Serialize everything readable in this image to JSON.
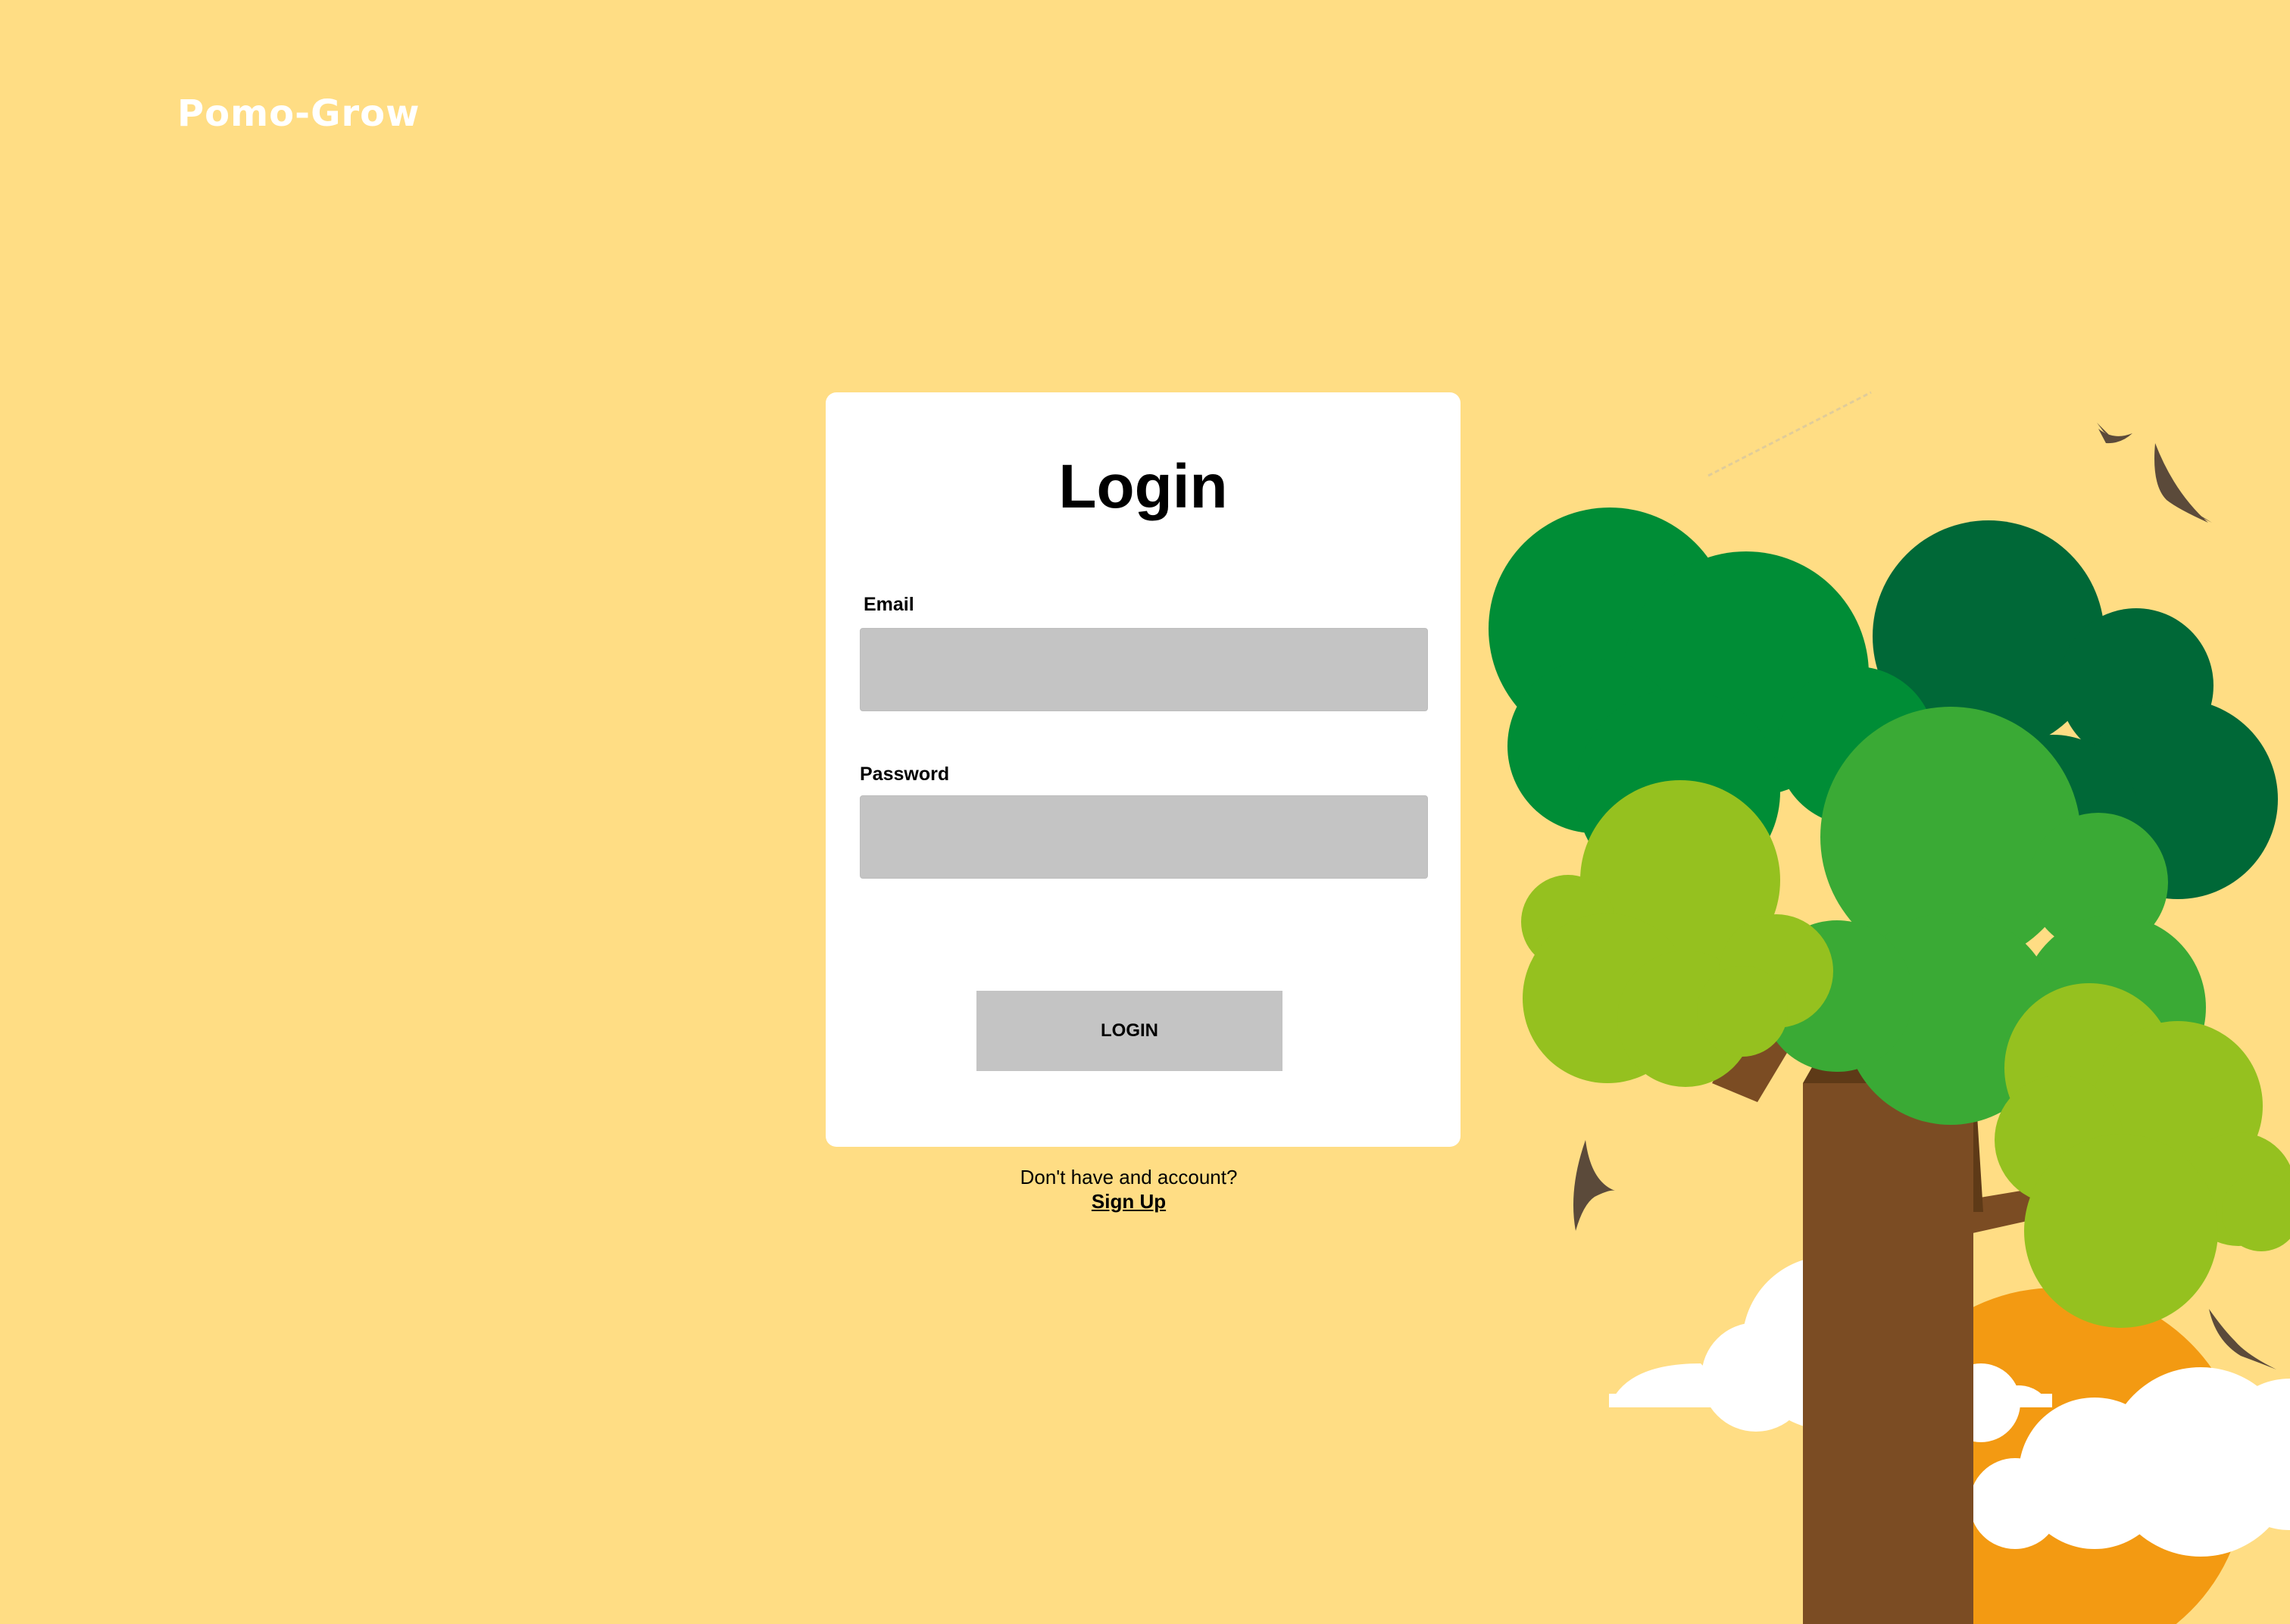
{
  "app": {
    "brand": "Pomo-Grow"
  },
  "login_card": {
    "title": "Login",
    "email_label": "Email",
    "email_value": "",
    "password_label": "Password",
    "password_value": "",
    "login_button_label": "LOGIN"
  },
  "signup": {
    "prompt": "Don't have and account?",
    "link_label": "Sign Up"
  },
  "colors": {
    "background": "#FFDD84",
    "card": "#FFFFFF",
    "input_fill": "#C4C4C4",
    "tree_trunk": "#7B4C23",
    "leaf_dark": "#006837",
    "leaf_mid": "#008D36",
    "leaf_green": "#3AAA35",
    "leaf_light": "#95C11F",
    "sun": "#F39A12",
    "bird": "#5B4A3A"
  },
  "illustration": {
    "icons": [
      "tree-illustration",
      "sun-icon",
      "cloud-icon",
      "bird-icon"
    ]
  }
}
